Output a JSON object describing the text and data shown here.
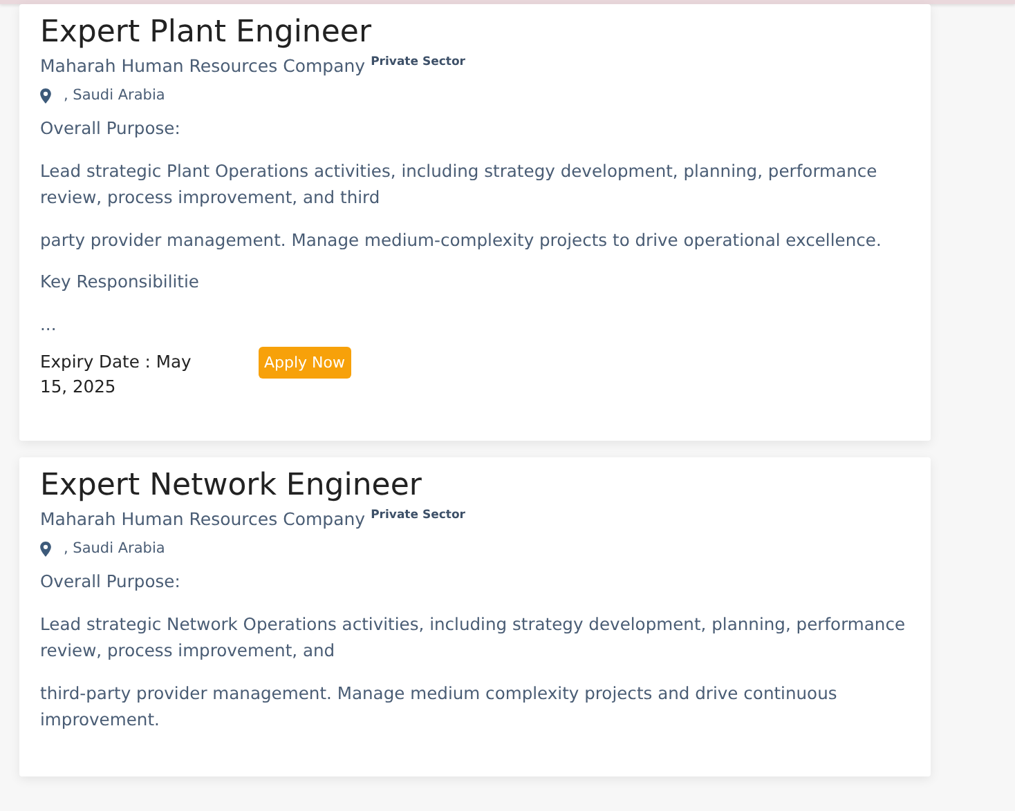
{
  "jobs": [
    {
      "title": "Expert Plant Engineer",
      "company": "Maharah Human Resources Company",
      "sector": "Private Sector",
      "location": ", Saudi Arabia",
      "paragraphs": [
        "Overall Purpose:",
        "Lead strategic Plant Operations activities, including strategy development, planning, performance review, process improvement, and third",
        "party provider management. Manage medium-complexity projects to drive operational excellence.",
        "Key Responsibilitie",
        "..."
      ],
      "expiry": "Expiry Date : May 15, 2025",
      "apply": "Apply Now"
    },
    {
      "title": "Expert Network Engineer",
      "company": "Maharah Human Resources Company",
      "sector": "Private Sector",
      "location": ", Saudi Arabia",
      "paragraphs": [
        "Overall Purpose:",
        "Lead strategic Network Operations activities, including strategy development, planning, performance review, process improvement, and",
        "third-party provider management. Manage medium complexity projects and drive continuous improvement."
      ]
    }
  ]
}
